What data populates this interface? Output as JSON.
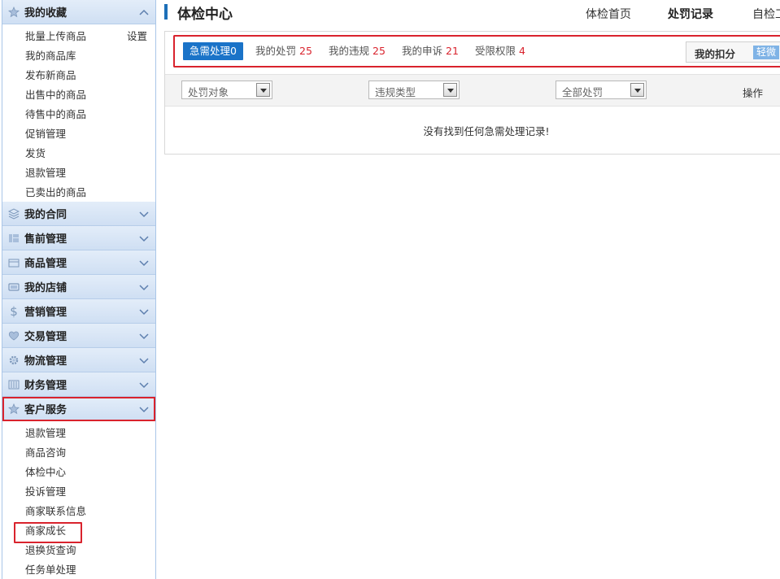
{
  "sidebar": {
    "favorites": {
      "title": "我的收藏",
      "settings_label": "设置",
      "items": [
        "批量上传商品",
        "我的商品库",
        "发布新商品",
        "出售中的商品",
        "待售中的商品",
        "促销管理",
        "发货",
        "退款管理",
        "已卖出的商品"
      ]
    },
    "sections": [
      {
        "title": "我的合同",
        "icon": "layers-icon"
      },
      {
        "title": "售前管理",
        "icon": "layout-icon"
      },
      {
        "title": "商品管理",
        "icon": "box-icon"
      },
      {
        "title": "我的店铺",
        "icon": "store-icon"
      },
      {
        "title": "营销管理",
        "icon": "dollar-icon"
      },
      {
        "title": "交易管理",
        "icon": "heart-icon"
      },
      {
        "title": "物流管理",
        "icon": "gear-icon"
      },
      {
        "title": "财务管理",
        "icon": "chart-icon"
      }
    ],
    "customer_service": {
      "title": "客户服务",
      "items": [
        "退款管理",
        "商品咨询",
        "体检中心",
        "投诉管理",
        "商家联系信息",
        "商家成长",
        "退换货查询",
        "任务单处理"
      ]
    }
  },
  "header": {
    "title": "体检中心",
    "nav": [
      "体检首页",
      "处罚记录",
      "自检工"
    ],
    "active_nav": "处罚记录"
  },
  "tabs": [
    {
      "label": "急需处理",
      "count": "0"
    },
    {
      "label": "我的处罚",
      "count": "25"
    },
    {
      "label": "我的违规",
      "count": "25"
    },
    {
      "label": "我的申诉",
      "count": "21"
    },
    {
      "label": "受限权限",
      "count": "4"
    }
  ],
  "score": {
    "label": "我的扣分",
    "level": "轻微"
  },
  "filters": {
    "target": "处罚对象",
    "violation_type": "违规类型",
    "penalty": "全部处罚",
    "op_label": "操作"
  },
  "empty_message": "没有找到任何急需处理记录!",
  "colors": {
    "accent": "#1a73c8",
    "highlight": "#d9232d",
    "sidebar_header": "#cfdff3"
  }
}
